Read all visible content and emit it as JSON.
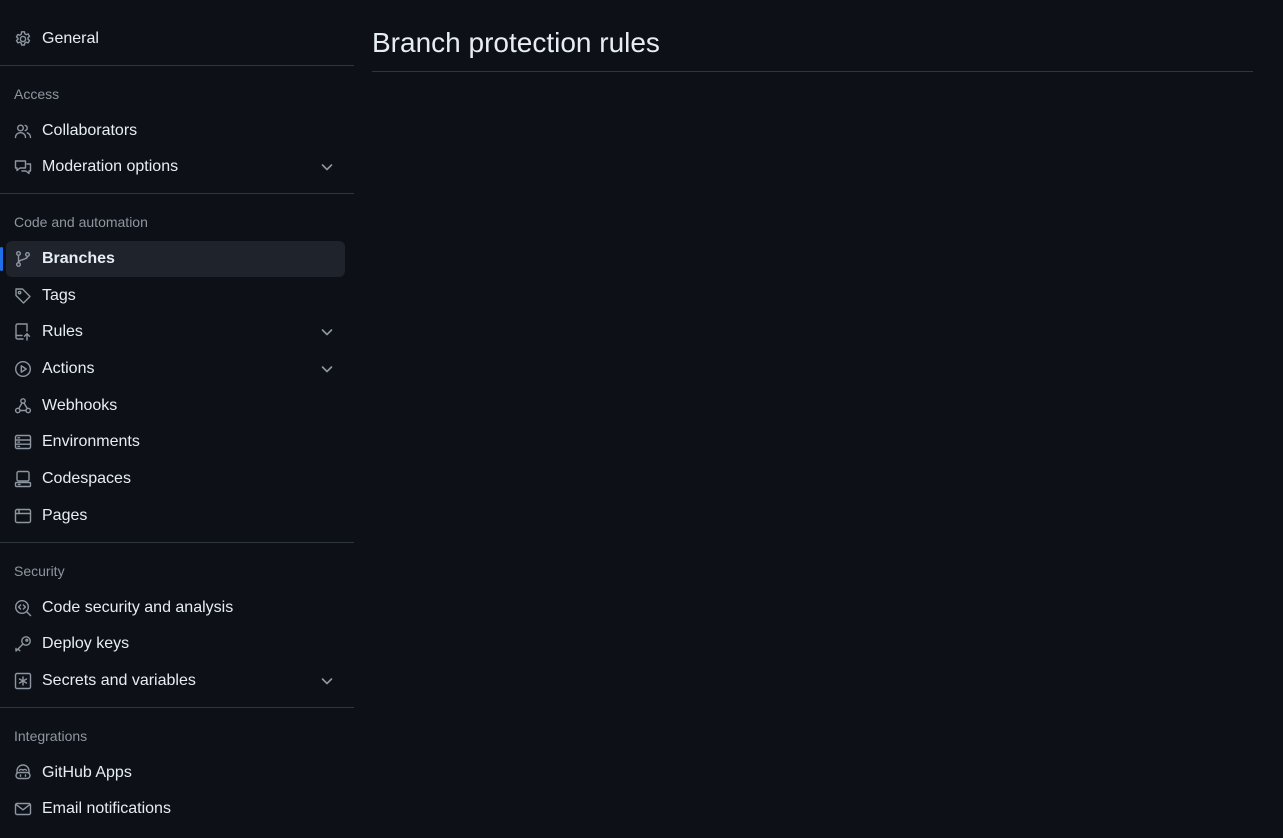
{
  "sidebar": {
    "general": {
      "label": "General",
      "icon": "gear-icon"
    },
    "access": {
      "heading": "Access",
      "collaborators": {
        "label": "Collaborators",
        "icon": "people-icon"
      },
      "moderation": {
        "label": "Moderation options",
        "icon": "comment-discussion-icon",
        "expandable": true
      }
    },
    "code_automation": {
      "heading": "Code and automation",
      "branches": {
        "label": "Branches",
        "icon": "git-branch-icon",
        "selected": true
      },
      "tags": {
        "label": "Tags",
        "icon": "tag-icon"
      },
      "rules": {
        "label": "Rules",
        "icon": "repo-push-icon",
        "expandable": true
      },
      "actions": {
        "label": "Actions",
        "icon": "play-icon",
        "expandable": true
      },
      "webhooks": {
        "label": "Webhooks",
        "icon": "webhook-icon"
      },
      "environments": {
        "label": "Environments",
        "icon": "server-icon"
      },
      "codespaces": {
        "label": "Codespaces",
        "icon": "codespaces-icon"
      },
      "pages": {
        "label": "Pages",
        "icon": "browser-icon"
      }
    },
    "security": {
      "heading": "Security",
      "code_security": {
        "label": "Code security and analysis",
        "icon": "codescan-icon"
      },
      "deploy_keys": {
        "label": "Deploy keys",
        "icon": "key-icon"
      },
      "secrets": {
        "label": "Secrets and variables",
        "icon": "key-asterisk-icon",
        "expandable": true
      }
    },
    "integrations": {
      "heading": "Integrations",
      "github_apps": {
        "label": "GitHub Apps",
        "icon": "copilot-icon"
      },
      "email_notifications": {
        "label": "Email notifications",
        "icon": "mail-icon"
      }
    }
  },
  "main": {
    "title": "Branch protection rules"
  },
  "colors": {
    "background": "#0d1117",
    "border": "#30363d",
    "text": "#e6edf3",
    "muted": "#8d96a0",
    "selected_bg": "#1f242c",
    "accent": "#1f6feb"
  }
}
